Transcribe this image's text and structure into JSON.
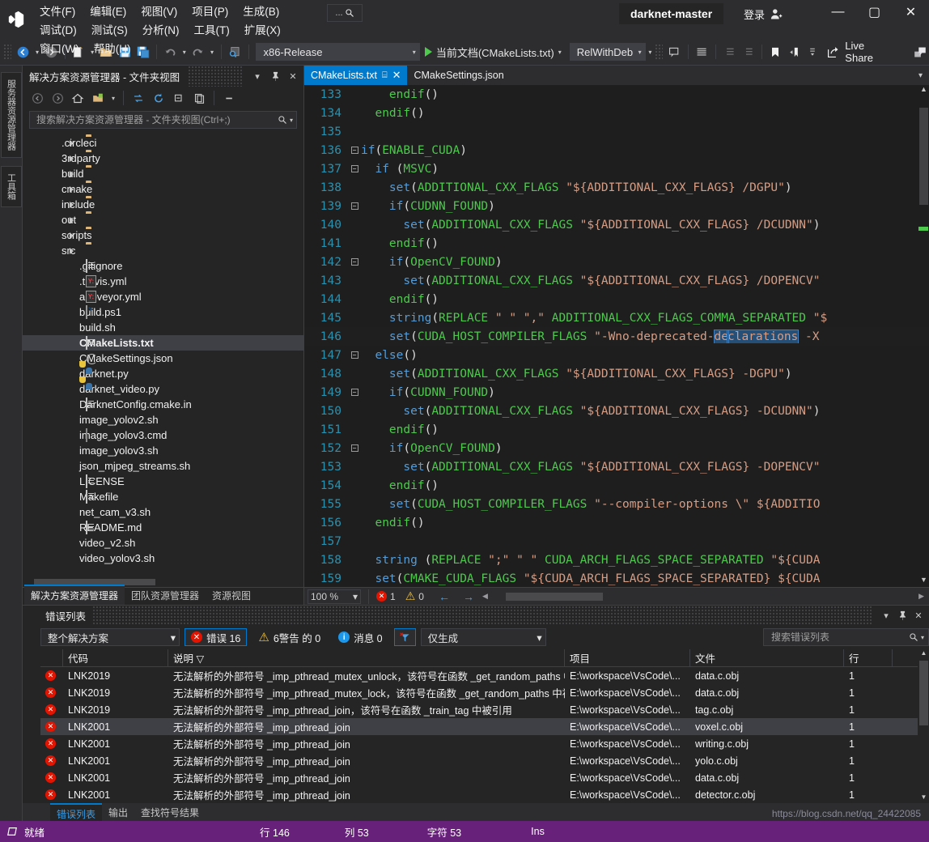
{
  "titlebar": {
    "menus": [
      {
        "label": "文件(F)",
        "name": "menu-file"
      },
      {
        "label": "编辑(E)",
        "name": "menu-edit"
      },
      {
        "label": "视图(V)",
        "name": "menu-view"
      },
      {
        "label": "项目(P)",
        "name": "menu-project"
      },
      {
        "label": "生成(B)",
        "name": "menu-build"
      },
      {
        "label": "调试(D)",
        "name": "menu-debug"
      },
      {
        "label": "测试(S)",
        "name": "menu-test"
      },
      {
        "label": "分析(N)",
        "name": "menu-analyze"
      },
      {
        "label": "工具(T)",
        "name": "menu-tools"
      },
      {
        "label": "扩展(X)",
        "name": "menu-extensions"
      },
      {
        "label": "窗口(W)",
        "name": "menu-window"
      },
      {
        "label": "帮助(H)",
        "name": "menu-help"
      }
    ],
    "quick_launch": "...",
    "solution_title": "darknet-master",
    "signin_label": "登录",
    "minimize": "—",
    "maximize": "▢",
    "close": "✕"
  },
  "toolbar": {
    "config_combo": "x86-Release",
    "run_label": "当前文档(CMakeLists.txt)",
    "build_type_combo": "RelWithDebInf",
    "live_share": "Live Share"
  },
  "left_rail": {
    "tabs": [
      "服务器资源管理器",
      "工具箱"
    ]
  },
  "solution_explorer": {
    "title": "解决方案资源管理器 - 文件夹视图",
    "search_placeholder": "搜索解决方案资源管理器 - 文件夹视图(Ctrl+;)",
    "tree": [
      {
        "label": ".circleci",
        "type": "folder"
      },
      {
        "label": "3rdparty",
        "type": "folder"
      },
      {
        "label": "build",
        "type": "folder"
      },
      {
        "label": "cmake",
        "type": "folder"
      },
      {
        "label": "include",
        "type": "folder"
      },
      {
        "label": "out",
        "type": "folder"
      },
      {
        "label": "scripts",
        "type": "folder"
      },
      {
        "label": "src",
        "type": "folder"
      },
      {
        "label": ".gitignore",
        "type": "doc"
      },
      {
        "label": ".travis.yml",
        "type": "yml"
      },
      {
        "label": "appveyor.yml",
        "type": "yml"
      },
      {
        "label": "build.ps1",
        "type": "ps"
      },
      {
        "label": "build.sh",
        "type": "none"
      },
      {
        "label": "CMakeLists.txt",
        "type": "doc",
        "selected": true
      },
      {
        "label": "CMakeSettings.json",
        "type": "json"
      },
      {
        "label": "darknet.py",
        "type": "py"
      },
      {
        "label": "darknet_video.py",
        "type": "py"
      },
      {
        "label": "DarknetConfig.cmake.in",
        "type": "blank"
      },
      {
        "label": "image_yolov2.sh",
        "type": "none"
      },
      {
        "label": "image_yolov3.cmd",
        "type": "cmd"
      },
      {
        "label": "image_yolov3.sh",
        "type": "none"
      },
      {
        "label": "json_mjpeg_streams.sh",
        "type": "none"
      },
      {
        "label": "LICENSE",
        "type": "blank"
      },
      {
        "label": "Makefile",
        "type": "blank"
      },
      {
        "label": "net_cam_v3.sh",
        "type": "none"
      },
      {
        "label": "README.md",
        "type": "doc"
      },
      {
        "label": "video_v2.sh",
        "type": "none"
      },
      {
        "label": "video_yolov3.sh",
        "type": "none"
      }
    ],
    "bottom_tabs": [
      {
        "label": "解决方案资源管理器",
        "active": true
      },
      {
        "label": "团队资源管理器",
        "active": false
      },
      {
        "label": "资源视图",
        "active": false
      }
    ]
  },
  "editor": {
    "tabs": [
      {
        "label": "CMakeLists.txt",
        "active": true
      },
      {
        "label": "CMakeSettings.json",
        "active": false
      }
    ],
    "lines": [
      {
        "n": "133",
        "fold": "",
        "indent": 4,
        "tokens": [
          {
            "t": "endif",
            "c": "fn"
          },
          {
            "t": "()",
            "c": "plain"
          }
        ]
      },
      {
        "n": "134",
        "fold": "",
        "indent": 2,
        "tokens": [
          {
            "t": "endif",
            "c": "fn"
          },
          {
            "t": "()",
            "c": "plain"
          }
        ]
      },
      {
        "n": "135",
        "fold": "",
        "indent": 0,
        "tokens": []
      },
      {
        "n": "136",
        "fold": "-",
        "indent": 0,
        "tokens": [
          {
            "t": "if",
            "c": "blue"
          },
          {
            "t": "(",
            "c": "plain"
          },
          {
            "t": "ENABLE_CUDA",
            "c": "fn"
          },
          {
            "t": ")",
            "c": "plain"
          }
        ]
      },
      {
        "n": "137",
        "fold": "-",
        "indent": 2,
        "tokens": [
          {
            "t": "if ",
            "c": "blue"
          },
          {
            "t": "(",
            "c": "plain"
          },
          {
            "t": "MSVC",
            "c": "fn"
          },
          {
            "t": ")",
            "c": "plain"
          }
        ]
      },
      {
        "n": "138",
        "fold": "",
        "indent": 4,
        "tokens": [
          {
            "t": "set",
            "c": "blue"
          },
          {
            "t": "(",
            "c": "plain"
          },
          {
            "t": "ADDITIONAL_CXX_FLAGS ",
            "c": "fn"
          },
          {
            "t": "\"${ADDITIONAL_CXX_FLAGS} /DGPU\"",
            "c": "str"
          },
          {
            "t": ")",
            "c": "plain"
          }
        ]
      },
      {
        "n": "139",
        "fold": "-",
        "indent": 4,
        "tokens": [
          {
            "t": "if",
            "c": "blue"
          },
          {
            "t": "(",
            "c": "plain"
          },
          {
            "t": "CUDNN_FOUND",
            "c": "fn"
          },
          {
            "t": ")",
            "c": "plain"
          }
        ]
      },
      {
        "n": "140",
        "fold": "",
        "indent": 6,
        "tokens": [
          {
            "t": "set",
            "c": "blue"
          },
          {
            "t": "(",
            "c": "plain"
          },
          {
            "t": "ADDITIONAL_CXX_FLAGS ",
            "c": "fn"
          },
          {
            "t": "\"${ADDITIONAL_CXX_FLAGS} /DCUDNN\"",
            "c": "str"
          },
          {
            "t": ")",
            "c": "plain"
          }
        ]
      },
      {
        "n": "141",
        "fold": "",
        "indent": 4,
        "tokens": [
          {
            "t": "endif",
            "c": "fn"
          },
          {
            "t": "()",
            "c": "plain"
          }
        ]
      },
      {
        "n": "142",
        "fold": "-",
        "indent": 4,
        "tokens": [
          {
            "t": "if",
            "c": "blue"
          },
          {
            "t": "(",
            "c": "plain"
          },
          {
            "t": "OpenCV_FOUND",
            "c": "fn"
          },
          {
            "t": ")",
            "c": "plain"
          }
        ]
      },
      {
        "n": "143",
        "fold": "",
        "indent": 6,
        "tokens": [
          {
            "t": "set",
            "c": "blue"
          },
          {
            "t": "(",
            "c": "plain"
          },
          {
            "t": "ADDITIONAL_CXX_FLAGS ",
            "c": "fn"
          },
          {
            "t": "\"${ADDITIONAL_CXX_FLAGS} /DOPENCV\"",
            "c": "str"
          }
        ]
      },
      {
        "n": "144",
        "fold": "",
        "indent": 4,
        "tokens": [
          {
            "t": "endif",
            "c": "fn"
          },
          {
            "t": "()",
            "c": "plain"
          }
        ]
      },
      {
        "n": "145",
        "fold": "",
        "indent": 4,
        "tokens": [
          {
            "t": "string",
            "c": "blue"
          },
          {
            "t": "(",
            "c": "plain"
          },
          {
            "t": "REPLACE ",
            "c": "fn"
          },
          {
            "t": "\" \" \",\"",
            "c": "str"
          },
          {
            "t": " ADDITIONAL_CXX_FLAGS_COMMA_SEPARATED ",
            "c": "fn"
          },
          {
            "t": "\"$",
            "c": "str"
          }
        ]
      },
      {
        "n": "146",
        "fold": "",
        "indent": 4,
        "selected": true,
        "tokens": [
          {
            "t": "set",
            "c": "blue"
          },
          {
            "t": "(",
            "c": "plain"
          },
          {
            "t": "CUDA_HOST_COMPILER_FLAGS ",
            "c": "fn"
          },
          {
            "t": "\"-Wno-deprecated-",
            "c": "str"
          },
          {
            "t": "de",
            "c": "selstart"
          },
          {
            "t": "clarations",
            "c": "sel"
          },
          {
            "t": " -X",
            "c": "str"
          }
        ]
      },
      {
        "n": "147",
        "fold": "-",
        "indent": 2,
        "tokens": [
          {
            "t": "else",
            "c": "blue"
          },
          {
            "t": "()",
            "c": "plain"
          }
        ]
      },
      {
        "n": "148",
        "fold": "",
        "indent": 4,
        "tokens": [
          {
            "t": "set",
            "c": "blue"
          },
          {
            "t": "(",
            "c": "plain"
          },
          {
            "t": "ADDITIONAL_CXX_FLAGS ",
            "c": "fn"
          },
          {
            "t": "\"${ADDITIONAL_CXX_FLAGS} -DGPU\"",
            "c": "str"
          },
          {
            "t": ")",
            "c": "plain"
          }
        ]
      },
      {
        "n": "149",
        "fold": "-",
        "indent": 4,
        "tokens": [
          {
            "t": "if",
            "c": "blue"
          },
          {
            "t": "(",
            "c": "plain"
          },
          {
            "t": "CUDNN_FOUND",
            "c": "fn"
          },
          {
            "t": ")",
            "c": "plain"
          }
        ]
      },
      {
        "n": "150",
        "fold": "",
        "indent": 6,
        "tokens": [
          {
            "t": "set",
            "c": "blue"
          },
          {
            "t": "(",
            "c": "plain"
          },
          {
            "t": "ADDITIONAL_CXX_FLAGS ",
            "c": "fn"
          },
          {
            "t": "\"${ADDITIONAL_CXX_FLAGS} -DCUDNN\"",
            "c": "str"
          },
          {
            "t": ")",
            "c": "plain"
          }
        ]
      },
      {
        "n": "151",
        "fold": "",
        "indent": 4,
        "tokens": [
          {
            "t": "endif",
            "c": "fn"
          },
          {
            "t": "()",
            "c": "plain"
          }
        ]
      },
      {
        "n": "152",
        "fold": "-",
        "indent": 4,
        "tokens": [
          {
            "t": "if",
            "c": "blue"
          },
          {
            "t": "(",
            "c": "plain"
          },
          {
            "t": "OpenCV_FOUND",
            "c": "fn"
          },
          {
            "t": ")",
            "c": "plain"
          }
        ]
      },
      {
        "n": "153",
        "fold": "",
        "indent": 6,
        "tokens": [
          {
            "t": "set",
            "c": "blue"
          },
          {
            "t": "(",
            "c": "plain"
          },
          {
            "t": "ADDITIONAL_CXX_FLAGS ",
            "c": "fn"
          },
          {
            "t": "\"${ADDITIONAL_CXX_FLAGS} -DOPENCV\"",
            "c": "str"
          }
        ]
      },
      {
        "n": "154",
        "fold": "",
        "indent": 4,
        "tokens": [
          {
            "t": "endif",
            "c": "fn"
          },
          {
            "t": "()",
            "c": "plain"
          }
        ]
      },
      {
        "n": "155",
        "fold": "",
        "indent": 4,
        "tokens": [
          {
            "t": "set",
            "c": "blue"
          },
          {
            "t": "(",
            "c": "plain"
          },
          {
            "t": "CUDA_HOST_COMPILER_FLAGS ",
            "c": "fn"
          },
          {
            "t": "\"--compiler-options \\\" ${ADDITIO",
            "c": "str"
          }
        ]
      },
      {
        "n": "156",
        "fold": "",
        "indent": 2,
        "tokens": [
          {
            "t": "endif",
            "c": "fn"
          },
          {
            "t": "()",
            "c": "plain"
          }
        ]
      },
      {
        "n": "157",
        "fold": "",
        "indent": 0,
        "tokens": []
      },
      {
        "n": "158",
        "fold": "",
        "indent": 2,
        "tokens": [
          {
            "t": "string ",
            "c": "blue"
          },
          {
            "t": "(",
            "c": "plain"
          },
          {
            "t": "REPLACE ",
            "c": "fn"
          },
          {
            "t": "\";\" \" \"",
            "c": "str"
          },
          {
            "t": " CUDA_ARCH_FLAGS_SPACE_SEPARATED ",
            "c": "fn"
          },
          {
            "t": "\"${CUDA",
            "c": "str"
          }
        ]
      },
      {
        "n": "159",
        "fold": "",
        "indent": 2,
        "tokens": [
          {
            "t": "set",
            "c": "blue"
          },
          {
            "t": "(",
            "c": "plain"
          },
          {
            "t": "CMAKE_CUDA_FLAGS ",
            "c": "fn"
          },
          {
            "t": "\"${CUDA_ARCH_FLAGS_SPACE_SEPARATED} ${CUDA",
            "c": "str"
          }
        ]
      }
    ],
    "status": {
      "zoom": "100 %",
      "error_count": "1",
      "warning_count": "0"
    }
  },
  "error_list": {
    "title": "错误列表",
    "scope_combo": "整个解决方案",
    "errors_label": "错误 16",
    "warnings_label": "6警告 的 0",
    "messages_label": "消息 0",
    "filter_combo": "仅生成",
    "search_placeholder": "搜索错误列表",
    "columns": [
      "代码",
      "说明 ▽",
      "项目",
      "文件",
      "行"
    ],
    "rows": [
      {
        "code": "LNK2019",
        "desc": "无法解析的外部符号 _imp_pthread_mutex_unlock，该符号在函数 _get_random_paths 中被引用",
        "project": "E:\\workspace\\VsCode\\...",
        "file": "data.c.obj",
        "line": "1",
        "selected": false
      },
      {
        "code": "LNK2019",
        "desc": "无法解析的外部符号 _imp_pthread_mutex_lock，该符号在函数 _get_random_paths 中被引用",
        "project": "E:\\workspace\\VsCode\\...",
        "file": "data.c.obj",
        "line": "1",
        "selected": false
      },
      {
        "code": "LNK2019",
        "desc": "无法解析的外部符号 _imp_pthread_join，该符号在函数 _train_tag 中被引用",
        "project": "E:\\workspace\\VsCode\\...",
        "file": "tag.c.obj",
        "line": "1",
        "selected": false
      },
      {
        "code": "LNK2001",
        "desc": "无法解析的外部符号 _imp_pthread_join",
        "project": "E:\\workspace\\VsCode\\...",
        "file": "voxel.c.obj",
        "line": "1",
        "selected": true
      },
      {
        "code": "LNK2001",
        "desc": "无法解析的外部符号 _imp_pthread_join",
        "project": "E:\\workspace\\VsCode\\...",
        "file": "writing.c.obj",
        "line": "1",
        "selected": false
      },
      {
        "code": "LNK2001",
        "desc": "无法解析的外部符号 _imp_pthread_join",
        "project": "E:\\workspace\\VsCode\\...",
        "file": "yolo.c.obj",
        "line": "1",
        "selected": false
      },
      {
        "code": "LNK2001",
        "desc": "无法解析的外部符号 _imp_pthread_join",
        "project": "E:\\workspace\\VsCode\\...",
        "file": "data.c.obj",
        "line": "1",
        "selected": false
      },
      {
        "code": "LNK2001",
        "desc": "无法解析的外部符号 _imp_pthread_join",
        "project": "E:\\workspace\\VsCode\\...",
        "file": "detector.c.obj",
        "line": "1",
        "selected": false
      }
    ],
    "bottom_tabs": [
      {
        "label": "错误列表",
        "active": true
      },
      {
        "label": "输出",
        "active": false
      },
      {
        "label": "查找符号结果",
        "active": false
      }
    ]
  },
  "statusbar": {
    "ready": "就绪",
    "row": "行 146",
    "col": "列 53",
    "char": "字符 53",
    "ins": "Ins",
    "watermark": "https://blog.csdn.net/qq_24422085"
  }
}
